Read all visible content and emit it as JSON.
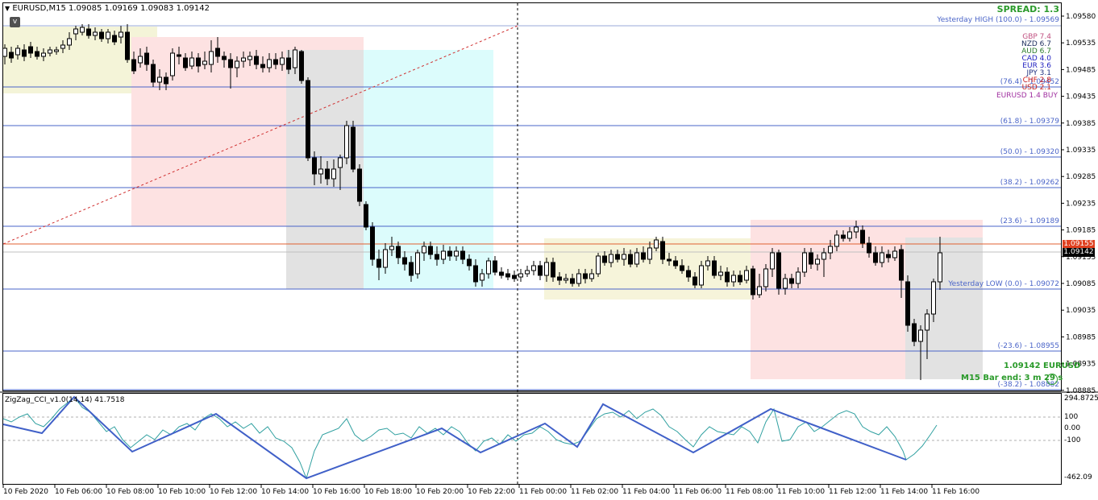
{
  "symbol_header": {
    "menu_glyph": "▼",
    "text": "EURUSD,M15  1.09085 1.09169 1.09083 1.09142",
    "collapse_button": "v"
  },
  "spread": "SPREAD: 1.3",
  "price_axis": [
    "1.09580",
    "1.09535",
    "1.09485",
    "1.09435",
    "1.09385",
    "1.09335",
    "1.09285",
    "1.09235",
    "1.09185",
    "1.09135",
    "1.09085",
    "1.09035",
    "1.08985",
    "1.08935",
    "1.08885"
  ],
  "price_markers": {
    "current_price": "1.09142",
    "line_price": "1.09155"
  },
  "level_labels": {
    "yesterday_high": {
      "label": "Yesterday HIGH",
      "value": "(100.0) - 1.09569"
    },
    "fib_76": "(76.4) - 1.09452",
    "fib_61": "(61.8) - 1.09379",
    "fib_50": "(50.0) - 1.09320",
    "fib_38": "(38.2) - 1.09262",
    "fib_23": "(23.6) - 1.09189",
    "yesterday_low": {
      "label": "Yesterday LOW",
      "value": "(0.0) - 1.09072"
    },
    "fib_m23": "(-23.6) - 1.08955",
    "fib_m38": "(-38.2) - 1.08882"
  },
  "currency_strength": [
    {
      "ccy": "GBP",
      "val": "7.4",
      "color": "#c05080"
    },
    {
      "ccy": "NZD",
      "val": "6.7",
      "color": "#203060"
    },
    {
      "ccy": "AUD",
      "val": "6.7",
      "color": "#2a7a2a"
    },
    {
      "ccy": "CAD",
      "val": "4.0",
      "color": "#2020c0"
    },
    {
      "ccy": "EUR",
      "val": "3.6",
      "color": "#2020c0"
    },
    {
      "ccy": "JPY",
      "val": "3.1",
      "color": "#203080"
    },
    {
      "ccy": "CHF",
      "val": "2.8",
      "color": "#d02020"
    },
    {
      "ccy": "USD",
      "val": "2.1",
      "color": "#c02020"
    }
  ],
  "signal": "EURUSD 1.4 BUY",
  "price_box": {
    "price_line": "1.09142  EURUSD",
    "bar_end": "M15 Bar end: 3 m 29 s"
  },
  "indicator": {
    "title": "ZigZag_CCI_v1.0(14,14) 41.7518",
    "axis": [
      "294.8725",
      "100",
      "0.00",
      "-100",
      "-462.09"
    ]
  },
  "time_axis": [
    "10 Feb 2020",
    "10 Feb 06:00",
    "10 Feb 08:00",
    "10 Feb 10:00",
    "10 Feb 12:00",
    "10 Feb 14:00",
    "10 Feb 16:00",
    "10 Feb 18:00",
    "10 Feb 20:00",
    "10 Feb 22:00",
    "11 Feb 00:00",
    "11 Feb 02:00",
    "11 Feb 04:00",
    "11 Feb 06:00",
    "11 Feb 08:00",
    "11 Feb 10:00",
    "11 Feb 12:00",
    "11 Feb 14:00",
    "11 Feb 16:00"
  ],
  "colors": {
    "bull": "#ffffff",
    "bear": "#000000",
    "fib_line": "#4a64c8",
    "price_line": "#e06030",
    "zigzag": "#4060c8",
    "cci": "#30a0a0"
  }
}
